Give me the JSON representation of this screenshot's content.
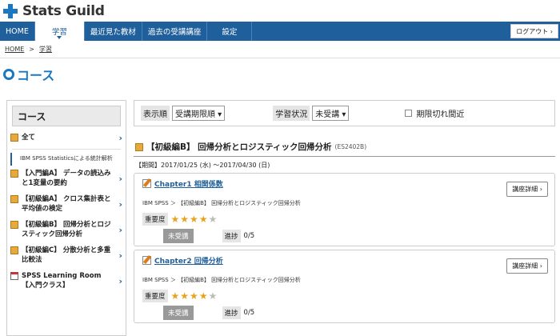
{
  "brand": {
    "name": "Stats Guild"
  },
  "nav": {
    "items": [
      {
        "label": "HOME",
        "active": false
      },
      {
        "label": "学習",
        "active": true
      },
      {
        "label": "最近見た教材",
        "active": false
      },
      {
        "label": "過去の受講講座",
        "active": false
      },
      {
        "label": "設定",
        "active": false
      }
    ],
    "logout": "ログアウト ›"
  },
  "breadcrumb": {
    "home": "HOME",
    "sep": ">",
    "current": "学習"
  },
  "page": {
    "title": "コース"
  },
  "sidebar": {
    "heading": "コース",
    "all": "全て",
    "group": "IBM SPSS Statisticsによる統計解析",
    "items": [
      {
        "label": "【入門編A】 データの読込みと1変量の要約",
        "icon": "cube-icon"
      },
      {
        "label": "【初級編A】 クロス集計表と平均値の検定",
        "icon": "cube-icon"
      },
      {
        "label": "【初級編B】 回帰分析とロジスティック回帰分析",
        "icon": "cube-icon"
      },
      {
        "label": "【初級編C】 分散分析と多重比較法",
        "icon": "cube-icon"
      },
      {
        "label": "SPSS Learning Room【入門クラス】",
        "icon": "calendar-icon"
      }
    ],
    "chevron": "›"
  },
  "filter": {
    "sort_label": "表示順",
    "sort_value": "受講期限順 ▾",
    "status_label": "学習状況",
    "status_value": "未受講 ▾",
    "expiring_label": "期限切れ間近"
  },
  "section": {
    "title": "【初級編B】 回帰分析とロジスティック回帰分析",
    "code": "(ES2402B)",
    "period": "【期間】2017/01/25 (水) ～2017/04/30 (日)"
  },
  "cards": [
    {
      "title": "Chapter1 相関係数",
      "button": "講座詳細 ›",
      "path": "IBM SPSS ＞ 【初級編B】 回帰分析とロジスティック回帰分析",
      "importance_label": "重要度",
      "stars": 4,
      "stars_max": 5,
      "status": "未受講",
      "progress_label": "進捗",
      "progress": "0/5"
    },
    {
      "title": "Chapter2 回帰分析",
      "button": "講座詳細 ›",
      "path": "IBM SPSS ＞ 【初級編B】 回帰分析とロジスティック回帰分析",
      "importance_label": "重要度",
      "stars": 4,
      "stars_max": 5,
      "status": "未受講",
      "progress_label": "進捗",
      "progress": "0/5"
    }
  ],
  "colors": {
    "accent": "#1a78c2",
    "nav": "#1f5f9c",
    "star": "#e8a21c"
  }
}
